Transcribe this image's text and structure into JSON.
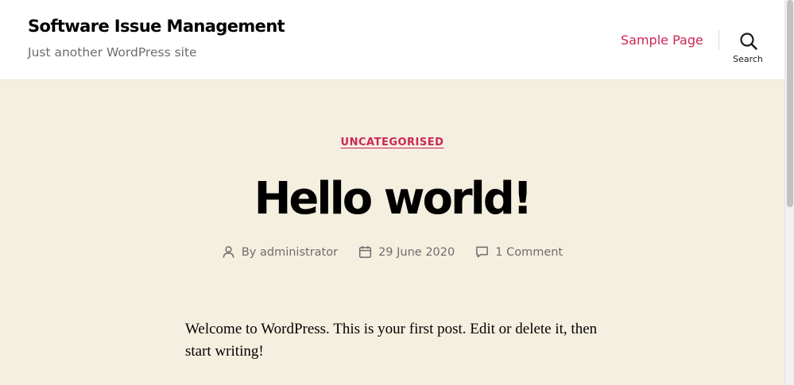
{
  "header": {
    "site_title": "Software Issue Management",
    "site_description": "Just another WordPress site",
    "nav_items": [
      {
        "label": "Sample Page"
      }
    ],
    "search_label": "Search",
    "search_icon": "search-icon"
  },
  "post": {
    "category": "UNCATEGORISED",
    "title": "Hello world!",
    "meta": {
      "author_prefix": "By",
      "author": "administrator",
      "author_icon": "person-icon",
      "date": "29 June 2020",
      "date_icon": "calendar-icon",
      "comments": "1 Comment",
      "comments_icon": "comment-icon"
    },
    "content": "Welcome to WordPress. This is your first post. Edit or delete it, then start writing!"
  },
  "colors": {
    "accent": "#cd2653",
    "background": "#f5efe0",
    "header_background": "#ffffff",
    "meta_text": "#6d6d6d"
  }
}
